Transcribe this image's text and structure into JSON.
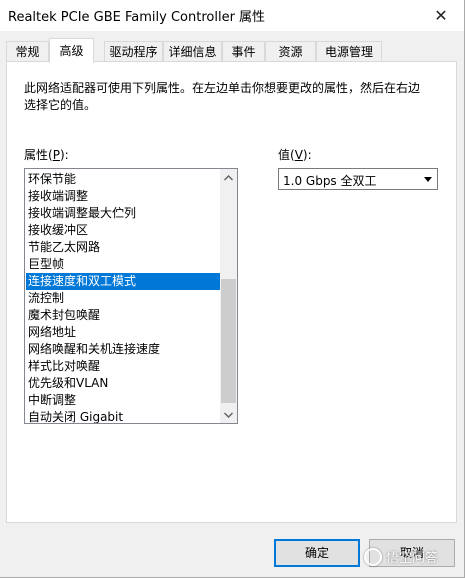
{
  "window": {
    "title": "Realtek PCIe GBE Family Controller 属性",
    "close_icon": "close-icon"
  },
  "tabs": [
    {
      "label": "常规"
    },
    {
      "label": "高级"
    },
    {
      "label": "驱动程序"
    },
    {
      "label": "详细信息"
    },
    {
      "label": "事件"
    },
    {
      "label": "资源"
    },
    {
      "label": "电源管理"
    }
  ],
  "active_tab": "高级",
  "panel": {
    "description": "此网络适配器可使用下列属性。在左边单击你想要更改的属性，然后在右边选择它的值。",
    "property_label_prefix": "属性(",
    "property_label_key": "P",
    "property_label_suffix": "):",
    "value_label_prefix": "值(",
    "value_label_key": "V",
    "value_label_suffix": "):",
    "properties": [
      "环保节能",
      "接收端调整",
      "接收端调整最大伫列",
      "接收缓冲区",
      "节能乙太网路",
      "巨型帧",
      "连接速度和双工模式",
      "流控制",
      "魔术封包唤醒",
      "网络地址",
      "网络唤醒和关机连接速度",
      "样式比对唤醒",
      "优先级和VLAN",
      "中断调整",
      "自动关闭 Gigabit"
    ],
    "selected_property": "连接速度和双工模式",
    "value_selected": "1.0 Gbps 全双工"
  },
  "buttons": {
    "ok": "确定",
    "cancel": "取消"
  },
  "watermark": {
    "text": "悟空问答"
  },
  "colors": {
    "selection": "#0078d7",
    "default_button_border": "#0078d7"
  }
}
